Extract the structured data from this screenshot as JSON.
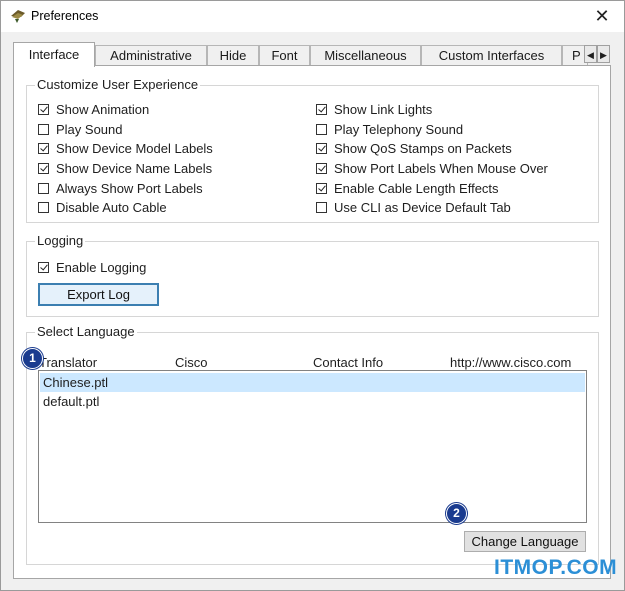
{
  "window": {
    "title": "Preferences"
  },
  "tabs": [
    {
      "label": "Interface",
      "active": true
    },
    {
      "label": "Administrative"
    },
    {
      "label": "Hide"
    },
    {
      "label": "Font"
    },
    {
      "label": "Miscellaneous"
    },
    {
      "label": "Custom Interfaces"
    },
    {
      "label": "P"
    }
  ],
  "customize": {
    "title": "Customize User Experience",
    "left": [
      {
        "label": "Show Animation",
        "checked": true
      },
      {
        "label": "Play Sound",
        "checked": false
      },
      {
        "label": "Show Device Model Labels",
        "checked": true
      },
      {
        "label": "Show Device Name Labels",
        "checked": true
      },
      {
        "label": "Always Show Port Labels",
        "checked": false
      },
      {
        "label": "Disable Auto Cable",
        "checked": false
      }
    ],
    "right": [
      {
        "label": "Show Link Lights",
        "checked": true
      },
      {
        "label": "Play Telephony Sound",
        "checked": false
      },
      {
        "label": "Show QoS Stamps on Packets",
        "checked": true
      },
      {
        "label": "Show Port Labels When Mouse Over",
        "checked": true
      },
      {
        "label": "Enable Cable Length Effects",
        "checked": true
      },
      {
        "label": "Use CLI as Device Default Tab",
        "checked": false
      }
    ]
  },
  "logging": {
    "title": "Logging",
    "enable_label": "Enable Logging",
    "enable_checked": true,
    "export_label": "Export Log"
  },
  "language": {
    "title": "Select Language",
    "headers": {
      "translator": "Translator",
      "company": "Cisco",
      "contact": "Contact Info",
      "url": "http://www.cisco.com"
    },
    "items": [
      {
        "label": "Chinese.ptl",
        "selected": true
      },
      {
        "label": "default.ptl",
        "selected": false
      }
    ],
    "change_label": "Change Language"
  },
  "annotations": {
    "badge1": "1",
    "badge2": "2"
  },
  "watermark": "ITMOP.COM",
  "colors": {
    "accent": "#1a3b8f",
    "selection": "#cce8ff",
    "watermark": "#2c8fd6"
  }
}
